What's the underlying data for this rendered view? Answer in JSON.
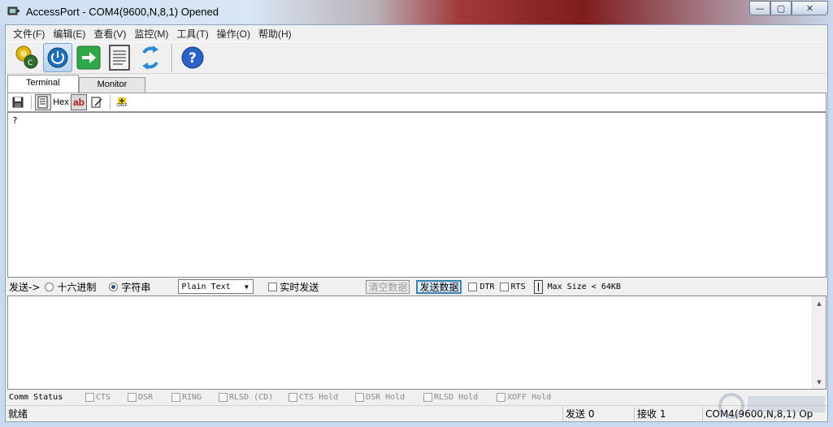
{
  "window": {
    "title": "AccessPort - COM4(9600,N,8,1) Opened",
    "controls": {
      "minimize": "—",
      "maximize": "▢",
      "close": "✕"
    }
  },
  "menu": [
    "文件(F)",
    "编辑(E)",
    "查看(V)",
    "监控(M)",
    "工具(T)",
    "操作(O)",
    "帮助(H)"
  ],
  "toolbar": {
    "icons": [
      "port-settings-icon",
      "power-icon",
      "go-arrow-icon",
      "document-icon",
      "refresh-icon",
      "help-icon"
    ]
  },
  "tabs": {
    "terminal": "Terminal",
    "monitor": "Monitor"
  },
  "subtoolbar": {
    "hex_label": "Hex",
    "ab_label": "ab",
    "crlf_label": "CRLF"
  },
  "terminal": {
    "content": "?"
  },
  "sendbar": {
    "label": "发送->",
    "radio_hex": "十六进制",
    "radio_string": "字符串",
    "format_selected": "Plain Text",
    "realtime_send": "实时发送",
    "clear_button": "清空数据",
    "send_button": "发送数据",
    "dtr": "DTR",
    "rts": "RTS",
    "max_size": "Max Size < 64KB"
  },
  "comm_status": {
    "label": "Comm Status",
    "items": [
      "CTS",
      "DSR",
      "RING",
      "RLSD (CD)",
      "CTS Hold",
      "DSR Hold",
      "RLSD Hold",
      "XOFF Hold"
    ]
  },
  "statusbar": {
    "ready": "就绪",
    "sent": "发送 0",
    "received": "接收 1",
    "port": "COM4(9600,N,8,1) Op"
  },
  "colors": {
    "accent": "#3c7fb1",
    "terminal_bg": "#ffffff",
    "frame_bg": "#f0f0f0"
  }
}
